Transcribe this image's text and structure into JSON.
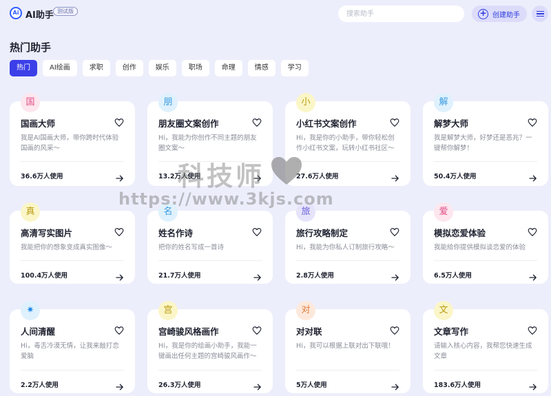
{
  "header": {
    "logo_glyph": "Ai",
    "app_name": "AI助手",
    "beta_label": "测试版",
    "search_placeholder": "搜索助手",
    "create_label": "创建助手",
    "create_icon": "plus-circle-icon",
    "menu_icon": "hamburger-menu-icon"
  },
  "section_title": "热门助手",
  "tabs": [
    {
      "label": "热门",
      "active": true
    },
    {
      "label": "AI绘画"
    },
    {
      "label": "求职"
    },
    {
      "label": "创作"
    },
    {
      "label": "娱乐"
    },
    {
      "label": "职场"
    },
    {
      "label": "命理"
    },
    {
      "label": "情感"
    },
    {
      "label": "学习"
    }
  ],
  "cards": [
    {
      "badge": "国",
      "badge_bg": "#fde6ee",
      "badge_fg": "#e04e86",
      "title": "国画大师",
      "desc": "我是AI国画大师，带你跨时代体验国画的风采～",
      "usage": "36.6万人使用"
    },
    {
      "badge": "朋",
      "badge_bg": "#dff1fd",
      "badge_fg": "#3a9be0",
      "title": "朋友圈文案创作",
      "desc": "Hi，我能为你创作不同主题的朋友圈文案～",
      "usage": "13.2万人使用"
    },
    {
      "badge": "小",
      "badge_bg": "#fbf6c8",
      "badge_fg": "#b99a10",
      "title": "小红书文案创作",
      "desc": "Hi，我是你的小助手，带你轻松创作小红书文案，玩转小红书社区～",
      "usage": "27.6万人使用"
    },
    {
      "badge": "解",
      "badge_bg": "#dff1fd",
      "badge_fg": "#3a9be0",
      "title": "解梦大师",
      "desc": "我是解梦大师，好梦还是恶兆？一键帮你解梦！",
      "usage": "50.4万人使用"
    },
    {
      "badge": "真",
      "badge_bg": "#fbf6c8",
      "badge_fg": "#b99a10",
      "title": "高清写实图片",
      "desc": "我能把你的想象变成真实图像～",
      "usage": "100.4万人使用"
    },
    {
      "badge": "名",
      "badge_bg": "#dff1fd",
      "badge_fg": "#3a9be0",
      "title": "姓名作诗",
      "desc": "把你的姓名写成一首诗",
      "usage": "21.7万人使用"
    },
    {
      "badge": "旅",
      "badge_bg": "#e6e4fb",
      "badge_fg": "#6a5fd8",
      "title": "旅行攻略制定",
      "desc": "Hi，我能为你私人订制旅行攻略～",
      "usage": "2.8万人使用"
    },
    {
      "badge": "爱",
      "badge_bg": "#fde6ee",
      "badge_fg": "#e04e86",
      "title": "模拟恋爱体验",
      "desc": "我能给你提供模拟谈恋爱的体验",
      "usage": "6.5万人使用"
    },
    {
      "badge": "✷",
      "badge_bg": "#dff1fd",
      "badge_fg": "#1e88e5",
      "title": "人间清醒",
      "desc": "Hi，毒舌冷漠无情，让我来敲打恋爱脑",
      "usage": "2.2万人使用"
    },
    {
      "badge": "宫",
      "badge_bg": "#fbf6c8",
      "badge_fg": "#b99a10",
      "title": "宫崎骏风格画作",
      "desc": "Hi，我是你的绘画小助手，我能一键画出任何主题的宫崎骏风画作～",
      "usage": "26.3万人使用"
    },
    {
      "badge": "对",
      "badge_bg": "#fde9dc",
      "badge_fg": "#e07a3a",
      "title": "对对联",
      "desc": "Hi，我可以根据上联对出下联哦！",
      "usage": "5万人使用"
    },
    {
      "badge": "文",
      "badge_bg": "#fbf6c8",
      "badge_fg": "#b99a10",
      "title": "文章写作",
      "desc": "请输入核心内容，我帮您快速生成文章",
      "usage": "183.6万人使用"
    }
  ],
  "card_icons": {
    "favorite": "heart-outline-icon",
    "open": "arrow-right-icon"
  },
  "watermark": {
    "text": "科技师",
    "url": "https://www.3kjs.com"
  },
  "colors": {
    "accent": "#3b3fe8",
    "background": "#edeefb"
  }
}
